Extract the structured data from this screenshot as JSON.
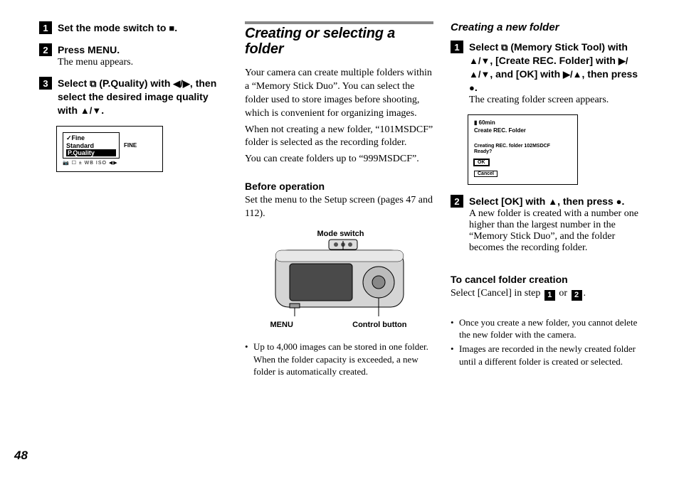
{
  "page_number": "48",
  "col1": {
    "steps": [
      {
        "num": "1",
        "head": [
          "Set the mode switch to ",
          "■",
          "."
        ]
      },
      {
        "num": "2",
        "head": [
          "Press MENU."
        ],
        "sub": "The menu appears."
      },
      {
        "num": "3",
        "head": [
          "Select ",
          "⧉",
          " (P.Quality) with ",
          "◀/▶",
          ", then select the desired image quality with ",
          "▲/▼",
          "."
        ]
      }
    ],
    "lcd": {
      "opt1": "Fine",
      "opt2": "Standard",
      "opt3": "P.Quality",
      "side": "FINE",
      "foot": "📷 ☐ ± WB ISO ◀▶"
    }
  },
  "col2": {
    "title": "Creating or selecting a folder",
    "para1": "Your camera can create multiple folders within a “Memory Stick Duo”. You can select the folder used to store images before shooting, which is convenient for organizing images.",
    "para2": "When not creating a new folder, “101MSDCF” folder is selected as the recording folder.",
    "para3": "You can create folders up to “999MSDCF”.",
    "before_head": "Before operation",
    "before_body": "Set the menu to the Setup screen (pages 47 and 112).",
    "labels": {
      "mode_switch": "Mode switch",
      "menu": "MENU",
      "control": "Control button"
    },
    "bullet1": "Up to 4,000 images can be stored in one folder. When the folder capacity is exceeded, a new folder is automatically created."
  },
  "col3": {
    "heading": "Creating a new folder",
    "steps": [
      {
        "num": "1",
        "head": [
          "Select ",
          "⧉",
          " (Memory Stick Tool) with ",
          "▲/▼",
          ", [Create REC. Folder] with ",
          "▶/▲/▼",
          ", and [OK] with ",
          "▶/▲",
          ", then press ",
          "●",
          "."
        ],
        "sub": "The creating folder screen appears."
      },
      {
        "num": "2",
        "head": [
          "Select [OK] with ",
          "▲",
          ", then press ",
          "●",
          "."
        ],
        "sub": "A new folder is created with a number one higher than the largest number in the “Memory Stick Duo”, and the folder becomes the recording folder."
      }
    ],
    "lcd": {
      "bat": "▮ 60min",
      "title": "Create REC. Folder",
      "msg": "Creating REC. folder 102MSDCF",
      "ready": "Ready?",
      "ok": "OK",
      "cancel": "Cancel"
    },
    "cancel_head": "To cancel folder creation",
    "cancel_body_a": "Select [Cancel] in step ",
    "cancel_body_or": " or ",
    "cancel_body_end": ".",
    "bullets": [
      "Once you create a new folder, you cannot delete the new folder with the camera.",
      "Images are recorded in the newly created folder until a different folder is created or selected."
    ]
  }
}
